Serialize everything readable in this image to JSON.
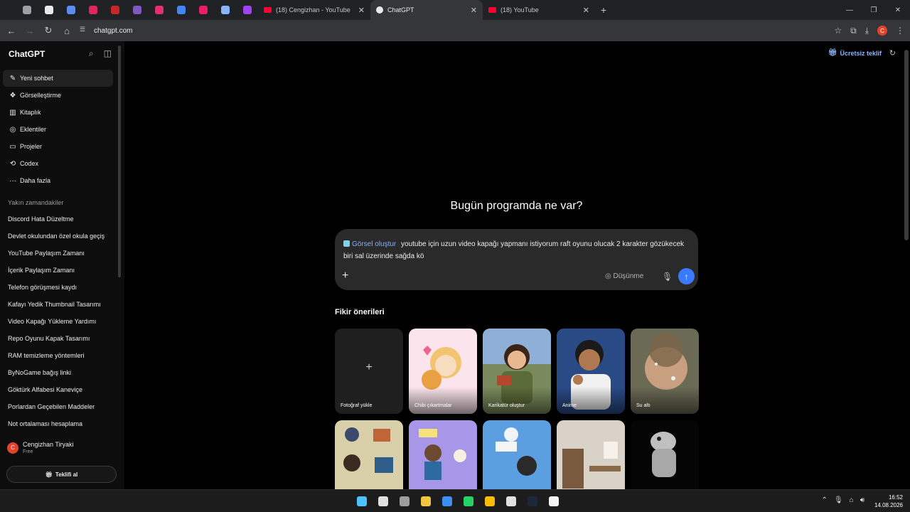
{
  "browser": {
    "pinned_tabs": [
      {
        "icon": "mute-icon",
        "color": "#9aa0a6"
      },
      {
        "icon": "shield-icon",
        "color": "#e8eaed"
      },
      {
        "icon": "grid-icon",
        "color": "#5b8def"
      },
      {
        "icon": "heart-icon",
        "color": "#e0245e"
      },
      {
        "icon": "crest-icon",
        "color": "#c62828"
      },
      {
        "icon": "play-icon",
        "color": "#7e57c2"
      },
      {
        "icon": "instagram-icon",
        "color": "#e1306c"
      },
      {
        "icon": "globe-icon",
        "color": "#4285f4"
      },
      {
        "icon": "camera-icon",
        "color": "#e91e63"
      },
      {
        "icon": "gemini-icon",
        "color": "#8ab4f8"
      },
      {
        "icon": "messenger-icon",
        "color": "#a142f4"
      }
    ],
    "tabs": [
      {
        "title": "(18) Cengizhan - YouTube",
        "favicon": "youtube-icon",
        "active": false
      },
      {
        "title": "ChatGPT",
        "favicon": "chatgpt-icon",
        "active": true
      },
      {
        "title": "(18) YouTube",
        "favicon": "youtube-icon",
        "active": false
      }
    ],
    "url": "chatgpt.com",
    "profile_initial": "C"
  },
  "sidebar": {
    "app_title": "ChatGPT",
    "nav": [
      {
        "label": "Yeni sohbet",
        "icon": "edit-icon",
        "selected": true
      },
      {
        "label": "Görselleştirme",
        "icon": "images-icon",
        "selected": false
      },
      {
        "label": "Kitaplık",
        "icon": "library-icon",
        "selected": false
      },
      {
        "label": "Eklentiler",
        "icon": "apps-icon",
        "selected": false
      },
      {
        "label": "Projeler",
        "icon": "folder-icon",
        "selected": false
      },
      {
        "label": "Codex",
        "icon": "codex-icon",
        "selected": false
      },
      {
        "label": "Daha fazla",
        "icon": "more-icon",
        "selected": false
      }
    ],
    "recent_label": "Yakın zamandakiler",
    "recent": [
      "Discord Hata Düzeltme",
      "Devlet okulundan özel okula geçiş",
      "YouTube Paylaşım Zamanı",
      "İçerik Paylaşım Zamanı",
      "Telefon görüşmesi kaydı",
      "Kafayı Yedik Thumbnail Tasarımı",
      "Video Kapağı Yükleme Yardımı",
      "Repo Oyunu Kapak Tasarımı",
      "RAM temizleme yöntemleri",
      "ByNoGame bağış linki",
      "Göktürk Alfabesi Kaneviçe",
      "Porlardan Geçebilen Maddeler",
      "Not ortalaması hesaplama"
    ],
    "user": {
      "initial": "C",
      "name": "Cengizhan Tiryaki",
      "plan": "Free"
    },
    "offer_button": "Teklifi al"
  },
  "header": {
    "offer_link": "Ücretsiz teklif"
  },
  "main": {
    "greeting": "Bugün programda ne var?",
    "composer": {
      "tool_chip": "Görsel oluştur",
      "text": "youtube için uzun video kapağı yapmanı istiyorum raft oyunu olucak 2 karakter gözükecek biri sal üzerinde sağda kö",
      "think_label": "Düşünme"
    },
    "ideas_title": "Fikir önerileri",
    "idea_cards": [
      {
        "label": "Fotoğraf yükle"
      },
      {
        "label": "Chibi çıkartmalar"
      },
      {
        "label": "Karikatür oluştur"
      },
      {
        "label": "Anime"
      },
      {
        "label": "Su altı"
      }
    ]
  },
  "taskbar": {
    "clock_time": "16:52",
    "clock_date": "14.08.2026",
    "apps": [
      {
        "icon": "windows-start-icon",
        "color": "#4cc2ff"
      },
      {
        "icon": "search-icon",
        "color": "#e0e0e0"
      },
      {
        "icon": "task-view-icon",
        "color": "#9e9e9e"
      },
      {
        "icon": "file-explorer-icon",
        "color": "#f4c542"
      },
      {
        "icon": "store-icon",
        "color": "#3c8ef0"
      },
      {
        "icon": "whatsapp-icon",
        "color": "#25d366"
      },
      {
        "icon": "chrome-icon",
        "color": "#fbbc04"
      },
      {
        "icon": "discord-icon",
        "color": "#e0e0e0"
      },
      {
        "icon": "steam-icon",
        "color": "#1b2838"
      },
      {
        "icon": "capcut-icon",
        "color": "#f5f5f5"
      }
    ]
  }
}
